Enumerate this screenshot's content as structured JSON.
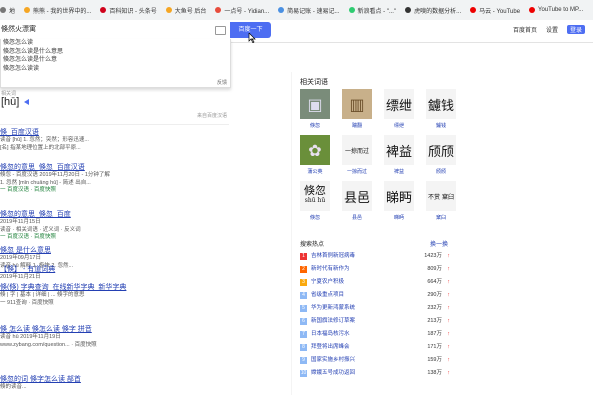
{
  "bookmarks": [
    {
      "label": "地",
      "color": "#777"
    },
    {
      "label": "熊熊 - 我的世界中的...",
      "color": "#f5a623"
    },
    {
      "label": "百科知识 - 头条号",
      "color": "#d0021b"
    },
    {
      "label": "大鱼号 后台",
      "color": "#f5a623"
    },
    {
      "label": "一点号 - Yidian...",
      "color": "#e74c3c"
    },
    {
      "label": "简易记账 - 速易记...",
      "color": "#4a90e2"
    },
    {
      "label": "新浪看点 - \"...\"",
      "color": "#2ecc71"
    },
    {
      "label": "虎嗅的数据分析...",
      "color": "#333"
    },
    {
      "label": "马云 - YouTube",
      "color": "#e00"
    },
    {
      "label": "YouTube to MP...",
      "color": "#e00"
    }
  ],
  "search": {
    "query": "倏然火漂寓",
    "button": "百度一下"
  },
  "top_links": [
    "百度首页",
    "设置",
    "登录"
  ],
  "suggestions": {
    "items": [
      "倏忽怎么读",
      "倏忽怎么读是什么意思",
      "倏忽怎么读是什么意",
      "倏忽怎么读读"
    ],
    "feedback": "反馈"
  },
  "pinyin_panel": {
    "label": "相关词",
    "pinyin": "[hū]",
    "more": "来自百度汉语"
  },
  "results": [
    {
      "title": "倏_百度汉语",
      "meta": "读音  [hū]  1. 忽然；突然；形容迅速...",
      "extra": "[名] 指某地理位置上的北部平原...",
      "green": ""
    },
    {
      "title": "倏忽的意思_倏忽_百度汉语",
      "meta": "倏忽 - 百度汉语  2019年11月20日 - 1分钟了解",
      "extra": "1. 忽然 [mǐn chuǎng hū] - 简述 出自...",
      "green": "一 百度汉语 · 百度快照"
    },
    {
      "title": "倏忽的意思_倏忽_百度",
      "meta": "2019年11月15日",
      "extra": "读音 · 相关词语 · 近义词 · 反义词",
      "green": "一 百度汉语 · 百度快照"
    },
    {
      "title": "倏忽 是什么意思",
      "meta": "2019年09月17日",
      "extra": "读音 hū  解释 1. 极快 2. 忽然...",
      "green": ""
    },
    {
      "title": "【倏】 - 有道词典",
      "meta": "2019年11月21日",
      "extra": "",
      "green": ""
    },
    {
      "title": "倏(倏) 字典查询_在线新华字典_新华字典",
      "meta": "倏 | 字 | 基本 | 详细 | ... 倏字的意思",
      "extra": "一 911查询 · 百度快照",
      "green": ""
    },
    {
      "title": "倏 怎么读 倏怎么读 倏字 拼音",
      "meta": "读音  hū  2019年11月19日",
      "extra": "www.zybang.com/question... · 百度快照",
      "green": ""
    },
    {
      "title": "倏忽的词 倏字怎么读 部首",
      "meta": "倏的读音...",
      "extra": "",
      "green": ""
    }
  ],
  "related": {
    "title": "相关词语",
    "items": [
      {
        "glyph": "▣",
        "caption": "倏忽"
      },
      {
        "glyph": "▥",
        "caption": "踹翻"
      },
      {
        "glyph": "缥绁",
        "caption": "缥绁"
      },
      {
        "glyph": "鑢钱",
        "caption": "鑢钱"
      },
      {
        "glyph": "✿",
        "caption": "蒲公英"
      },
      {
        "glyph": "一掠而过",
        "caption": "一掠而过"
      },
      {
        "glyph": "裨益",
        "caption": "裨益"
      },
      {
        "glyph": "颀颀",
        "caption": "颀颀"
      },
      {
        "glyph": "倏忽",
        "caption": "倏忽"
      },
      {
        "glyph": "县邑",
        "caption": "县邑"
      },
      {
        "glyph": "睇眄",
        "caption": "睇眄"
      },
      {
        "glyph": "不赏 窠臼",
        "caption": "窠臼"
      }
    ],
    "pinyin_on_item9": "shū hū"
  },
  "hot": {
    "title": "搜索热点",
    "change": "换一换",
    "items": [
      {
        "rank": "1",
        "title": "吉林首例新冠病毒",
        "count": "1423万",
        "color": "#e33"
      },
      {
        "rank": "2",
        "title": "新时代有新作为",
        "count": "809万",
        "color": "#f60"
      },
      {
        "rank": "3",
        "title": "宁夏农户积极",
        "count": "664万",
        "color": "#faa90e"
      },
      {
        "rank": "4",
        "title": "省级重点项目",
        "count": "290万",
        "color": "#8eb9f5"
      },
      {
        "rank": "5",
        "title": "华为更新鸿蒙系统",
        "count": "232万",
        "color": "#8eb9f5"
      },
      {
        "rank": "6",
        "title": "新国旗法修订草案",
        "count": "213万",
        "color": "#8eb9f5"
      },
      {
        "rank": "7",
        "title": "日本福岛核污水",
        "count": "187万",
        "color": "#8eb9f5"
      },
      {
        "rank": "8",
        "title": "拜登将出席峰会",
        "count": "171万",
        "color": "#8eb9f5"
      },
      {
        "rank": "9",
        "title": "国家实施乡村振兴",
        "count": "159万",
        "color": "#8eb9f5"
      },
      {
        "rank": "10",
        "title": "嫦娥五号成功返回",
        "count": "138万",
        "color": "#8eb9f5"
      }
    ]
  }
}
